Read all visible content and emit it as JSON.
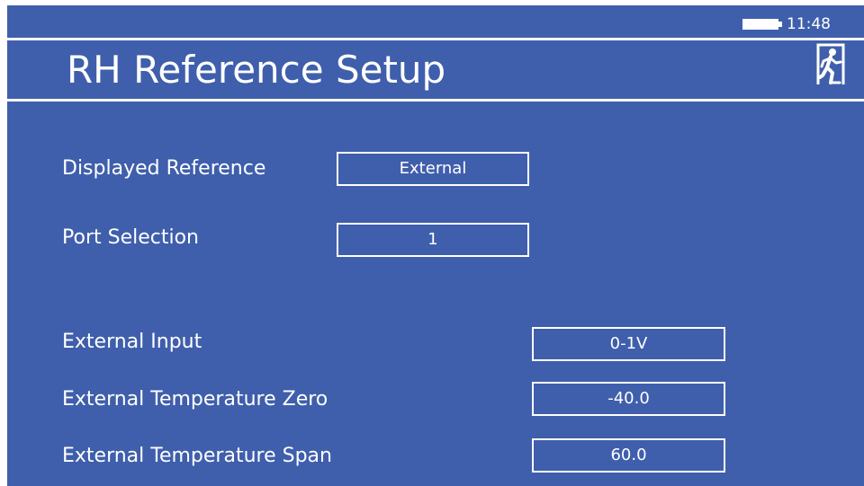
{
  "status": {
    "time": "11:48",
    "battery_icon": "battery-icon"
  },
  "header": {
    "title": "RH Reference Setup",
    "exit_icon": "exit-icon"
  },
  "fields": {
    "displayed_reference": {
      "label": "Displayed Reference",
      "value": "External"
    },
    "port_selection": {
      "label": "Port Selection",
      "value": "1"
    },
    "external_input": {
      "label": "External Input",
      "value": "0-1V"
    },
    "external_temp_zero": {
      "label": "External Temperature Zero",
      "value": "-40.0"
    },
    "external_temp_span": {
      "label": "External Temperature Span",
      "value": "60.0"
    }
  },
  "colors": {
    "background": "#3f5fac",
    "foreground": "#ffffff"
  }
}
